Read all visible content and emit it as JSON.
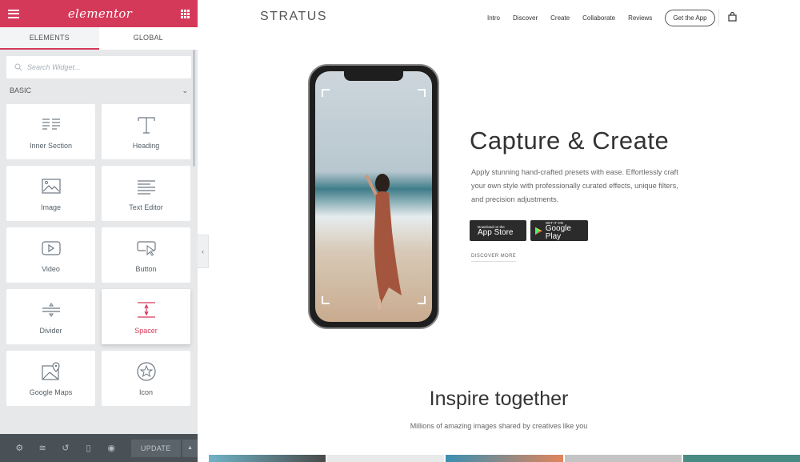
{
  "editor": {
    "logo": "elementor",
    "tabs": [
      {
        "label": "ELEMENTS",
        "active": true
      },
      {
        "label": "GLOBAL",
        "active": false
      }
    ],
    "search_placeholder": "Search Widget...",
    "category": "BASIC",
    "widgets": [
      {
        "label": "Inner Section",
        "icon": "inner-section-icon"
      },
      {
        "label": "Heading",
        "icon": "heading-icon"
      },
      {
        "label": "Image",
        "icon": "image-icon"
      },
      {
        "label": "Text Editor",
        "icon": "text-editor-icon"
      },
      {
        "label": "Video",
        "icon": "video-icon"
      },
      {
        "label": "Button",
        "icon": "button-icon"
      },
      {
        "label": "Divider",
        "icon": "divider-icon"
      },
      {
        "label": "Spacer",
        "icon": "spacer-icon",
        "selected": true
      },
      {
        "label": "Google Maps",
        "icon": "google-maps-icon"
      },
      {
        "label": "Icon",
        "icon": "star-icon"
      }
    ],
    "bottom": {
      "update_label": "UPDATE"
    },
    "accent": "#d5395a"
  },
  "site": {
    "brand": "STRATUS",
    "nav": [
      "Intro",
      "Discover",
      "Create",
      "Collaborate",
      "Reviews"
    ],
    "cta": "Get the App",
    "hero": {
      "title": "Capture & Create",
      "description": "Apply stunning hand-crafted presets with ease. Effortlessly craft your own style with professionally curated effects, unique filters, and precision adjustments.",
      "app_store": {
        "small": "Download on the",
        "large": "App Store"
      },
      "google_play": {
        "small": "GET IT ON",
        "large": "Google Play"
      },
      "discover": "DISCOVER MORE"
    },
    "section": {
      "title": "Inspire together",
      "subtitle": "Millions of amazing images shared by creatives like you"
    }
  }
}
